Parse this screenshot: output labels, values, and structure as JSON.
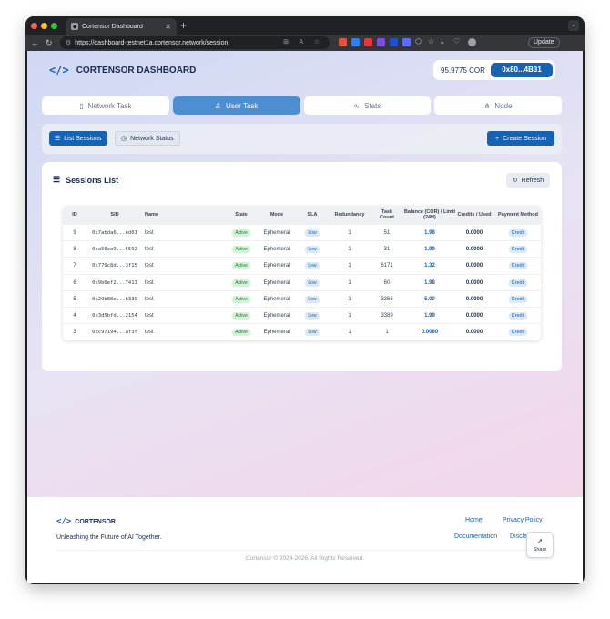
{
  "browser": {
    "tab_title": "Cortensor Dashboard",
    "new_tab_symbol": "+",
    "url": "https://dashboard-testnet1a.cortensor.network/session",
    "update_label": "Update"
  },
  "header": {
    "logo_glyph": "</>",
    "app_title": "CORTENSOR DASHBOARD",
    "balance": "95.9775 COR",
    "wallet_address": "0x80...4B31"
  },
  "main_tabs": [
    {
      "label": "Network Task",
      "icon": "file-icon"
    },
    {
      "label": "User Task",
      "icon": "user-icon",
      "active": true
    },
    {
      "label": "Stats",
      "icon": "activity-icon"
    },
    {
      "label": "Node",
      "icon": "network-icon"
    }
  ],
  "subnav": {
    "list_sessions": "List Sessions",
    "network_status": "Network Status",
    "create_session": "Create Session"
  },
  "sessions": {
    "title": "Sessions List",
    "refresh": "Refresh",
    "columns": [
      "ID",
      "SID",
      "Name",
      "State",
      "Mode",
      "SLA",
      "Redundancy",
      "Task Count",
      "Balance (COR) / Limit (24H)",
      "Credits / Used",
      "Payment Method"
    ],
    "rows": [
      {
        "id": "9",
        "sid": "0x7abda6...ed01",
        "name": "test",
        "state": "Active",
        "mode": "Ephemeral",
        "sla": "Low",
        "redundancy": "1",
        "task_count": "51",
        "balance": "1.98",
        "credits": "0.0000",
        "payment": "Credit"
      },
      {
        "id": "8",
        "sid": "0xa56ca9...5592",
        "name": "test",
        "state": "Active",
        "mode": "Ephemeral",
        "sla": "Low",
        "redundancy": "1",
        "task_count": "31",
        "balance": "1.99",
        "credits": "0.0000",
        "payment": "Credit"
      },
      {
        "id": "7",
        "sid": "0x779c8d...3f15",
        "name": "test",
        "state": "Active",
        "mode": "Ephemeral",
        "sla": "Low",
        "redundancy": "1",
        "task_count": "6171",
        "balance": "1.32",
        "credits": "0.0000",
        "payment": "Credit"
      },
      {
        "id": "6",
        "sid": "0x9b0ef2...7413",
        "name": "test",
        "state": "Active",
        "mode": "Ephemeral",
        "sla": "Low",
        "redundancy": "1",
        "task_count": "60",
        "balance": "1.98",
        "credits": "0.0000",
        "payment": "Credit"
      },
      {
        "id": "5",
        "sid": "0x29b88e...b339",
        "name": "test",
        "state": "Active",
        "mode": "Ephemeral",
        "sla": "Low",
        "redundancy": "1",
        "task_count": "3366",
        "balance": "5.00",
        "credits": "0.0000",
        "payment": "Credit"
      },
      {
        "id": "4",
        "sid": "0x3d5bfd...2154",
        "name": "test",
        "state": "Active",
        "mode": "Ephemeral",
        "sla": "Low",
        "redundancy": "1",
        "task_count": "3389",
        "balance": "1.99",
        "credits": "0.0000",
        "payment": "Credit"
      },
      {
        "id": "3",
        "sid": "0xc97194...af3f",
        "name": "test",
        "state": "Active",
        "mode": "Ephemeral",
        "sla": "Low",
        "redundancy": "1",
        "task_count": "1",
        "balance": "0.0060",
        "credits": "0.0000",
        "payment": "Credit"
      }
    ]
  },
  "footer": {
    "brand": "CORTENSOR",
    "tagline": "Unleashing the Future of AI Together.",
    "home": "Home",
    "privacy": "Privacy Policy",
    "documentation": "Documentation",
    "disclaimer_partial": "Discla",
    "copyright": "Cortensor © 2024-2026. All Rights Reserved.",
    "share": "Share"
  },
  "colors": {
    "accent": "#1662b5",
    "active_tab": "#4c8ed2",
    "status_active": "#1f7a34"
  }
}
